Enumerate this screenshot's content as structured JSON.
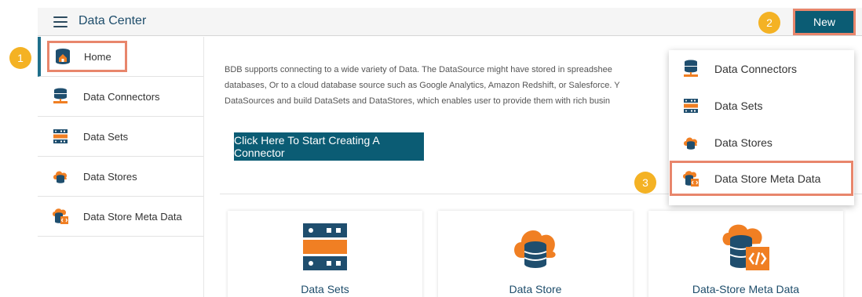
{
  "header": {
    "title": "Data Center",
    "new_label": "New"
  },
  "badges": {
    "one": "1",
    "two": "2",
    "three": "3"
  },
  "sidebar": {
    "items": [
      {
        "label": "Home",
        "icon": "home-database-icon"
      },
      {
        "label": "Data Connectors",
        "icon": "database-icon"
      },
      {
        "label": "Data Sets",
        "icon": "server-rack-icon"
      },
      {
        "label": "Data Stores",
        "icon": "cloud-database-icon"
      },
      {
        "label": "Data Store Meta Data",
        "icon": "database-code-icon"
      }
    ]
  },
  "main": {
    "description": [
      "BDB supports connecting to a wide variety of Data. The DataSource might have stored in spreadshee",
      "databases, Or to a cloud database source such as Google Analytics, Amazon Redshift, or Salesforce. Y",
      "DataSources and build DataSets and DataStores, which enables user to provide them with rich busin"
    ],
    "cta_label": "Click Here To Start Creating A Connector",
    "cards": [
      {
        "label": "Data Sets",
        "icon": "server-rack-icon"
      },
      {
        "label": "Data Store",
        "icon": "cloud-database-icon"
      },
      {
        "label": "Data-Store Meta Data",
        "icon": "database-code-icon"
      }
    ]
  },
  "dropdown": {
    "items": [
      {
        "label": "Data Connectors",
        "icon": "database-icon"
      },
      {
        "label": "Data Sets",
        "icon": "server-rack-icon"
      },
      {
        "label": "Data Stores",
        "icon": "cloud-database-icon"
      },
      {
        "label": "Data Store Meta Data",
        "icon": "database-code-icon"
      }
    ]
  },
  "colors": {
    "primary": "#0b5c74",
    "highlight": "#e8866c",
    "badge": "#f4b224",
    "icon_orange": "#f07f23",
    "icon_dark": "#1f4e6e"
  }
}
